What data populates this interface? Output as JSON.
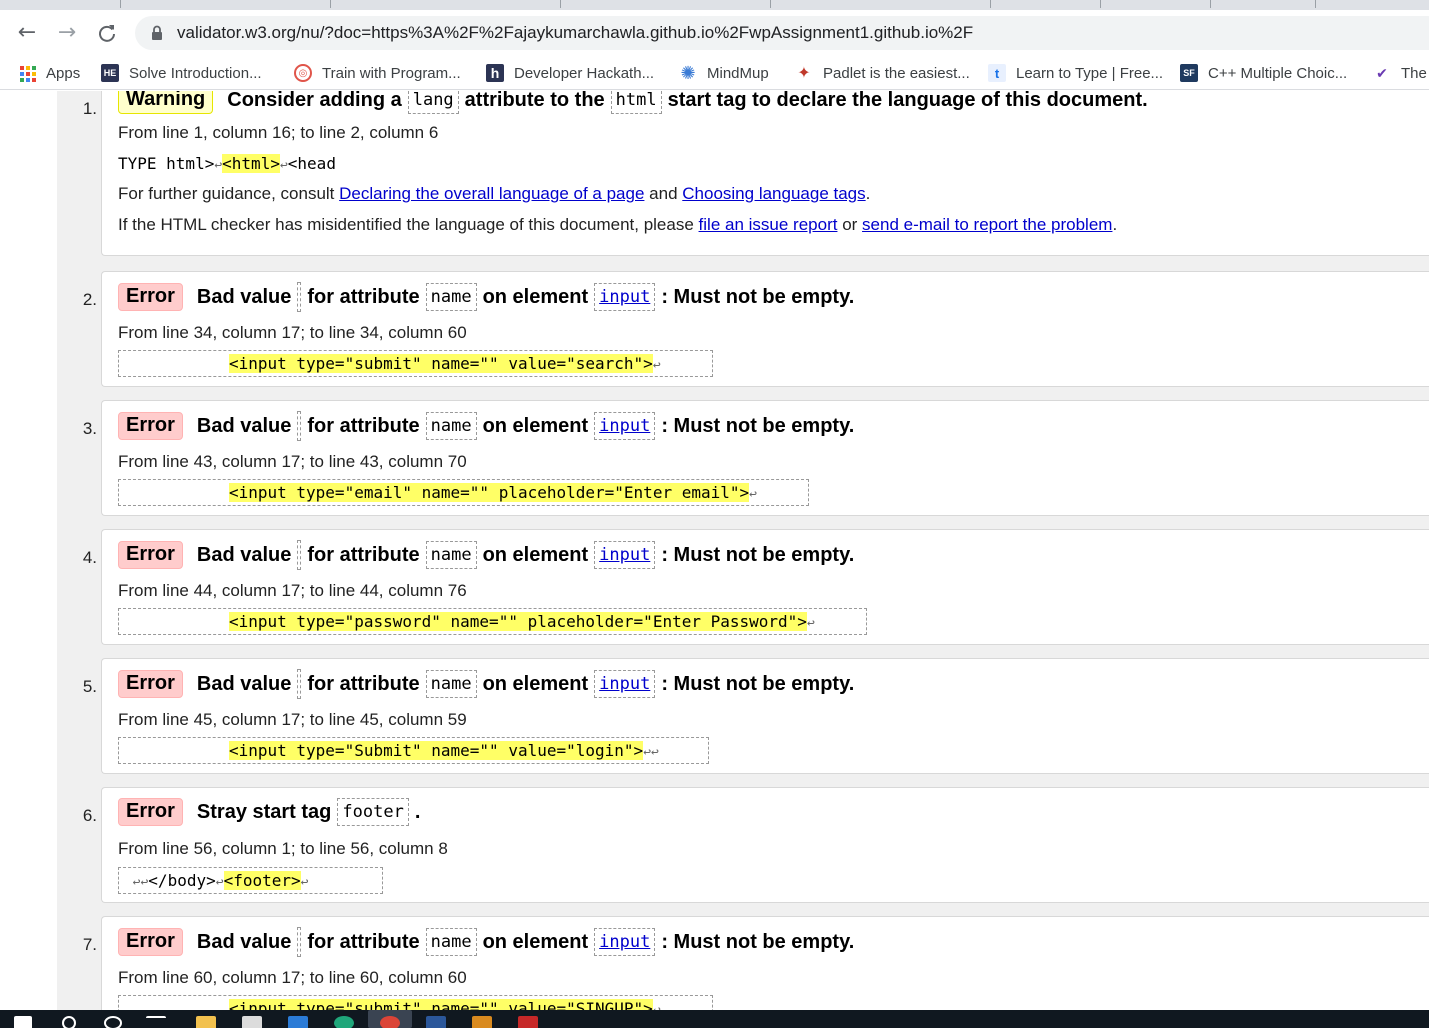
{
  "browser": {
    "url": "validator.w3.org/nu/?doc=https%3A%2F%2Fajaykumarchawla.github.io%2FwpAssignment1.github.io%2F",
    "bookmarks": [
      {
        "label": "Apps",
        "icon": "apps-grid-icon"
      },
      {
        "label": "Solve Introduction...",
        "icon": "hackerearth-icon"
      },
      {
        "label": "Train with Program...",
        "icon": "codewars-icon"
      },
      {
        "label": "Developer Hackath...",
        "icon": "hackathon-h-icon"
      },
      {
        "label": "MindMup",
        "icon": "mindmup-icon"
      },
      {
        "label": "Padlet is the easiest...",
        "icon": "padlet-icon"
      },
      {
        "label": "Learn to Type | Free...",
        "icon": "typing-t-icon"
      },
      {
        "label": "C++ Multiple Choic...",
        "icon": "sanfoundry-sf-icon"
      },
      {
        "label": "The",
        "icon": "bird-icon"
      }
    ]
  },
  "messages": [
    {
      "number": "1.",
      "type": "Warning",
      "text1": "Consider adding a",
      "code1": "lang",
      "text2": "attribute to the",
      "code2": "html",
      "text3": "start tag to declare the language of this document.",
      "location": "From line 1, column 16; to line 2, column 6",
      "extract_pre": "TYPE html>",
      "extract_hl": "<html>",
      "extract_post": "<head",
      "guidance_pre": "For further guidance, consult",
      "guidance_link1": "Declaring the overall language of a page",
      "guidance_and": "and",
      "guidance_link2": "Choosing language tags",
      "guidance_end": ".",
      "report_pre": "If the HTML checker has misidentified the language of this document, please",
      "report_link1": "file an issue report",
      "report_or": "or",
      "report_link2": "send e-mail to report the problem",
      "report_end": "."
    },
    {
      "number": "2.",
      "type": "Error",
      "text_bad": "Bad value",
      "text_for": "for attribute",
      "attr": "name",
      "text_on": "on element",
      "element": "input",
      "text_end": ": Must not be empty.",
      "location": "From line 34, column 17; to line 34, column 60",
      "extract": "<input type=\"submit\" name=\"\" value=\"search\">"
    },
    {
      "number": "3.",
      "type": "Error",
      "text_bad": "Bad value",
      "text_for": "for attribute",
      "attr": "name",
      "text_on": "on element",
      "element": "input",
      "text_end": ": Must not be empty.",
      "location": "From line 43, column 17; to line 43, column 70",
      "extract": "<input type=\"email\" name=\"\" placeholder=\"Enter email\">"
    },
    {
      "number": "4.",
      "type": "Error",
      "text_bad": "Bad value",
      "text_for": "for attribute",
      "attr": "name",
      "text_on": "on element",
      "element": "input",
      "text_end": ": Must not be empty.",
      "location": "From line 44, column 17; to line 44, column 76",
      "extract": "<input type=\"password\" name=\"\" placeholder=\"Enter Password\">"
    },
    {
      "number": "5.",
      "type": "Error",
      "text_bad": "Bad value",
      "text_for": "for attribute",
      "attr": "name",
      "text_on": "on element",
      "element": "input",
      "text_end": ": Must not be empty.",
      "location": "From line 45, column 17; to line 45, column 59",
      "extract": "<input type=\"Submit\" name=\"\" value=\"login\">"
    },
    {
      "number": "6.",
      "type": "Error",
      "text1": "Stray start tag",
      "code1": "footer",
      "text_end": ".",
      "location": "From line 56, column 1; to line 56, column 8",
      "extract_pre": "</body>",
      "extract_hl": "<footer>"
    },
    {
      "number": "7.",
      "type": "Error",
      "text_bad": "Bad value",
      "text_for": "for attribute",
      "attr": "name",
      "text_on": "on element",
      "element": "input",
      "text_end": ": Must not be empty.",
      "location": "From line 60, column 17; to line 60, column 60",
      "extract": "<input type=\"submit\" name=\"\" value=\"SINGUP\">"
    }
  ],
  "symbols": {
    "return": "↩"
  },
  "colors": {
    "error_badge": "#ffcccc",
    "warning_badge": "#ffffcc",
    "highlight": "#ffff66",
    "link": "#0000cc"
  }
}
